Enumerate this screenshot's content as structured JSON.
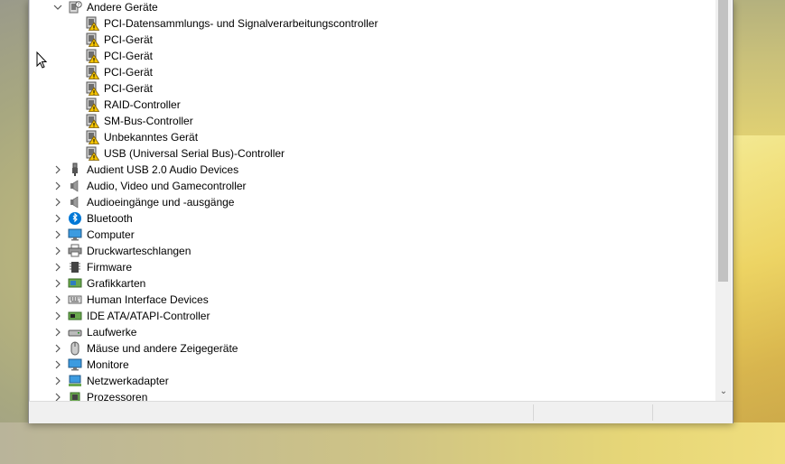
{
  "device_tree": {
    "category_expanded": {
      "label": "Andere Geräte",
      "icon": "other-devices-icon",
      "children": [
        {
          "label": "PCI-Datensammlungs- und Signalverarbeitungscontroller",
          "icon": "warning-device-icon"
        },
        {
          "label": "PCI-Gerät",
          "icon": "warning-device-icon"
        },
        {
          "label": "PCI-Gerät",
          "icon": "warning-device-icon"
        },
        {
          "label": "PCI-Gerät",
          "icon": "warning-device-icon"
        },
        {
          "label": "PCI-Gerät",
          "icon": "warning-device-icon"
        },
        {
          "label": "RAID-Controller",
          "icon": "warning-device-icon"
        },
        {
          "label": "SM-Bus-Controller",
          "icon": "warning-device-icon"
        },
        {
          "label": "Unbekanntes Gerät",
          "icon": "warning-device-icon"
        },
        {
          "label": "USB (Universal Serial Bus)-Controller",
          "icon": "warning-device-icon"
        }
      ]
    },
    "categories": [
      {
        "label": "Audient USB 2.0 Audio Devices",
        "icon": "usb-plug-icon"
      },
      {
        "label": "Audio, Video und Gamecontroller",
        "icon": "speaker-icon"
      },
      {
        "label": "Audioeingänge und -ausgänge",
        "icon": "speaker-icon"
      },
      {
        "label": "Bluetooth",
        "icon": "bluetooth-icon"
      },
      {
        "label": "Computer",
        "icon": "monitor-icon"
      },
      {
        "label": "Druckwarteschlangen",
        "icon": "printer-icon"
      },
      {
        "label": "Firmware",
        "icon": "chip-icon"
      },
      {
        "label": "Grafikkarten",
        "icon": "display-adapter-icon"
      },
      {
        "label": "Human Interface Devices",
        "icon": "keyboard-icon"
      },
      {
        "label": "IDE ATA/ATAPI-Controller",
        "icon": "ide-controller-icon"
      },
      {
        "label": "Laufwerke",
        "icon": "drive-icon"
      },
      {
        "label": "Mäuse und andere Zeigegeräte",
        "icon": "mouse-icon"
      },
      {
        "label": "Monitore",
        "icon": "monitor-icon"
      },
      {
        "label": "Netzwerkadapter",
        "icon": "network-adapter-icon"
      },
      {
        "label": "Prozessoren",
        "icon": "processor-icon"
      }
    ]
  },
  "colors": {
    "accent": "#0078d7",
    "warning": "#f5c400",
    "selection": "#cce8ff"
  }
}
